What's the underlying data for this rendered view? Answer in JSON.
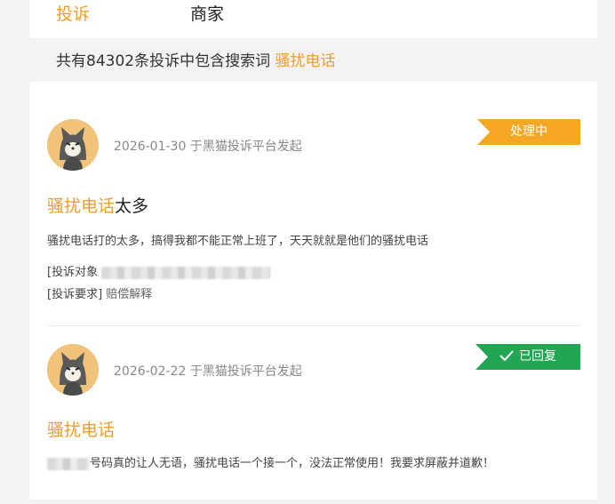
{
  "tabs": [
    {
      "label": "投诉",
      "active": true
    },
    {
      "label": "商家",
      "active": false
    }
  ],
  "summary": {
    "prefix": "共有84302条投诉中包含搜索词 ",
    "keyword": "骚扰电话"
  },
  "complaints": [
    {
      "meta": "2026-01-30 于黑猫投诉平台发起",
      "status": "处理中",
      "title_highlight": "骚扰电话",
      "title_rest": "太多",
      "description": "骚扰电话打的太多，搞得我都不能正常上班了，天天就就是他们的骚扰电话",
      "target_label": "[投诉对象",
      "request_label": "[投诉要求]",
      "request_value": "赔偿解释"
    },
    {
      "meta": "2026-02-22 于黑猫投诉平台发起",
      "status": "已回复",
      "status_icon": "check-icon",
      "title_highlight": "骚扰电话",
      "title_rest": "",
      "description": "号码真的让人无语，骚扰电话一个接一个，没法正常使用！我要求屏蔽并道歉！"
    }
  ],
  "colors": {
    "accent": "#f39c2b",
    "processing": "#f5a623",
    "replied": "#21a753"
  }
}
